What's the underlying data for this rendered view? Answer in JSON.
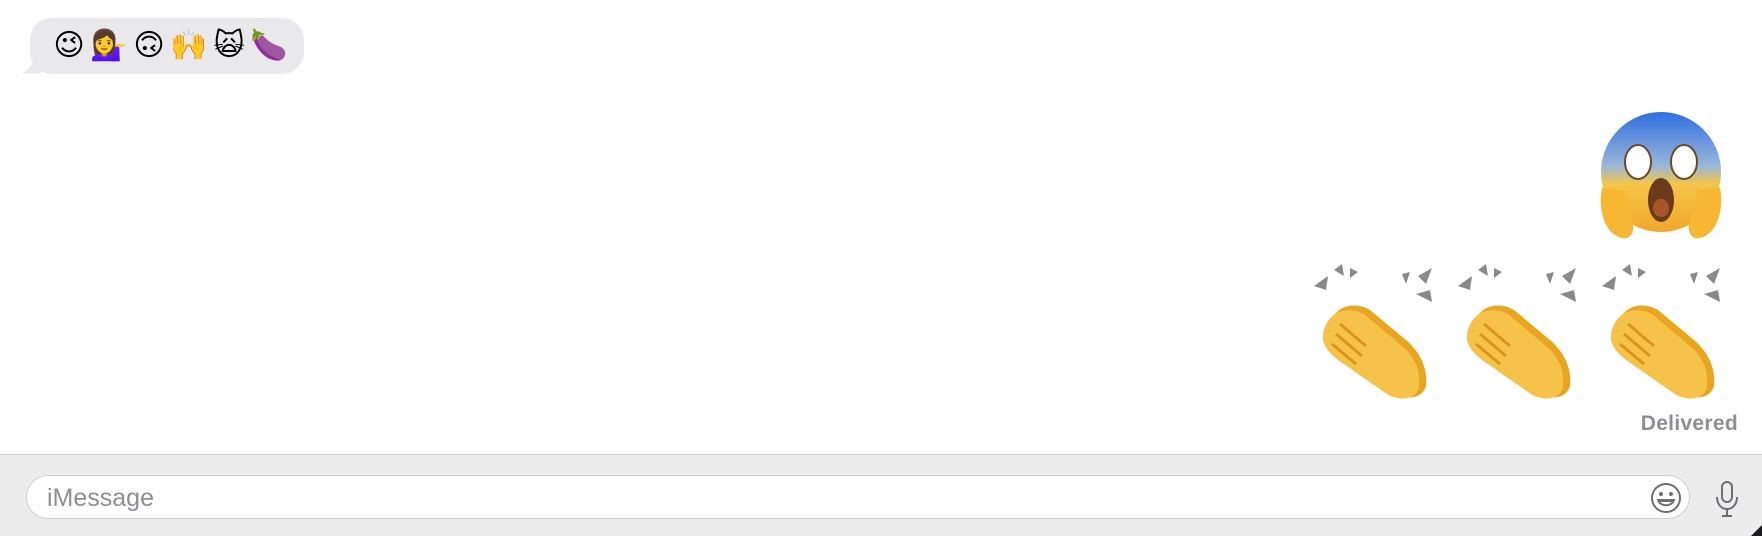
{
  "conversation": {
    "incoming_message": {
      "emojis": [
        "😉",
        "💁‍♀️",
        "🙃",
        "🙌",
        "🙀",
        "🍆"
      ]
    },
    "outgoing_messages": [
      {
        "emoji": "😱",
        "icon": "face-screaming-in-fear-icon"
      },
      {
        "emojis": [
          "👏",
          "👏",
          "👏"
        ],
        "icon": "clapping-hands-icon"
      }
    ],
    "status": "Delivered"
  },
  "composer": {
    "placeholder": "iMessage",
    "value": "",
    "emoji_button_icon": "smiley-face-icon",
    "mic_button_icon": "microphone-icon"
  },
  "colors": {
    "incoming_bubble": "#e9e9eb",
    "status_text": "#8e8e93",
    "composer_bg": "#ececec"
  }
}
